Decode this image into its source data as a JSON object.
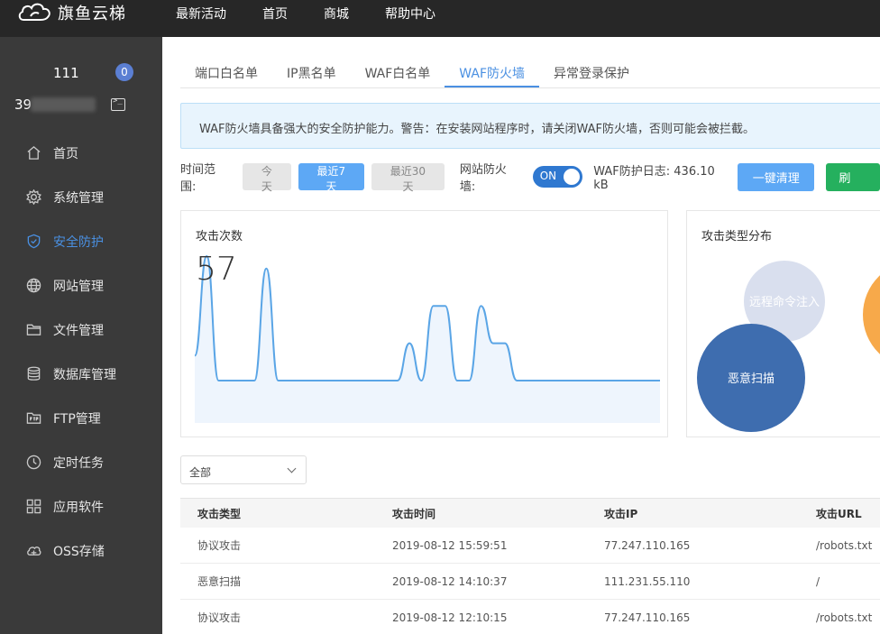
{
  "brand": {
    "name": "旗鱼云梯"
  },
  "topnav": [
    "最新活动",
    "首页",
    "商城",
    "帮助中心"
  ],
  "user": {
    "name": "111",
    "badge": "0",
    "id_prefix": "39"
  },
  "sidebar": {
    "items": [
      {
        "label": "首页",
        "icon": "home-icon"
      },
      {
        "label": "系统管理",
        "icon": "gear-icon"
      },
      {
        "label": "安全防护",
        "icon": "shield-icon",
        "active": true
      },
      {
        "label": "网站管理",
        "icon": "globe-icon"
      },
      {
        "label": "文件管理",
        "icon": "folder-icon"
      },
      {
        "label": "数据库管理",
        "icon": "database-icon"
      },
      {
        "label": "FTP管理",
        "icon": "ftp-icon"
      },
      {
        "label": "定时任务",
        "icon": "clock-icon"
      },
      {
        "label": "应用软件",
        "icon": "apps-icon"
      },
      {
        "label": "OSS存储",
        "icon": "cloud-storage-icon"
      }
    ]
  },
  "tabs": [
    {
      "label": "端口白名单"
    },
    {
      "label": "IP黑名单"
    },
    {
      "label": "WAF白名单"
    },
    {
      "label": "WAF防火墙",
      "active": true
    },
    {
      "label": "异常登录保护"
    }
  ],
  "notice": "WAF防火墙具备强大的安全防护能力。警告：在安装网站程序时，请关闭WAF防火墙，否则可能会被拦截。",
  "toolbar": {
    "range_label": "时间范围:",
    "ranges": [
      {
        "label": "今天"
      },
      {
        "label": "最近7天",
        "active": true
      },
      {
        "label": "最近30天"
      }
    ],
    "waf_label": "网站防火墙:",
    "toggle_text": "ON",
    "log_label": "WAF防护日志: 436.10 kB",
    "clean_label": "一键清理",
    "refresh_label": "刷"
  },
  "attack_count": {
    "title": "攻击次数",
    "value": "57",
    "series": [
      2,
      10,
      0,
      0,
      0,
      0,
      9,
      0,
      0,
      0,
      0,
      0,
      0,
      0,
      0,
      0,
      0,
      0,
      3,
      0,
      6,
      6,
      0,
      0,
      6,
      3,
      3,
      0,
      0,
      0,
      0,
      0,
      0,
      0,
      0,
      0,
      0,
      0,
      0,
      0
    ]
  },
  "attack_types": {
    "title": "攻击类型分布",
    "bubbles": [
      {
        "label": "远程命令注入",
        "color": "#d9dfee"
      },
      {
        "label": "恶意扫描",
        "color": "#3e6daf"
      },
      {
        "label": "",
        "color": "#f7a94a"
      }
    ]
  },
  "filter": {
    "selected": "全部"
  },
  "table": {
    "headers": [
      "攻击类型",
      "攻击时间",
      "攻击IP",
      "攻击URL"
    ],
    "rows": [
      [
        "协议攻击",
        "2019-08-12 15:59:51",
        "77.247.110.165",
        "/robots.txt"
      ],
      [
        "恶意扫描",
        "2019-08-12 14:10:37",
        "111.231.55.110",
        "/"
      ],
      [
        "协议攻击",
        "2019-08-12 12:10:15",
        "77.247.110.165",
        "/robots.txt"
      ]
    ]
  }
}
